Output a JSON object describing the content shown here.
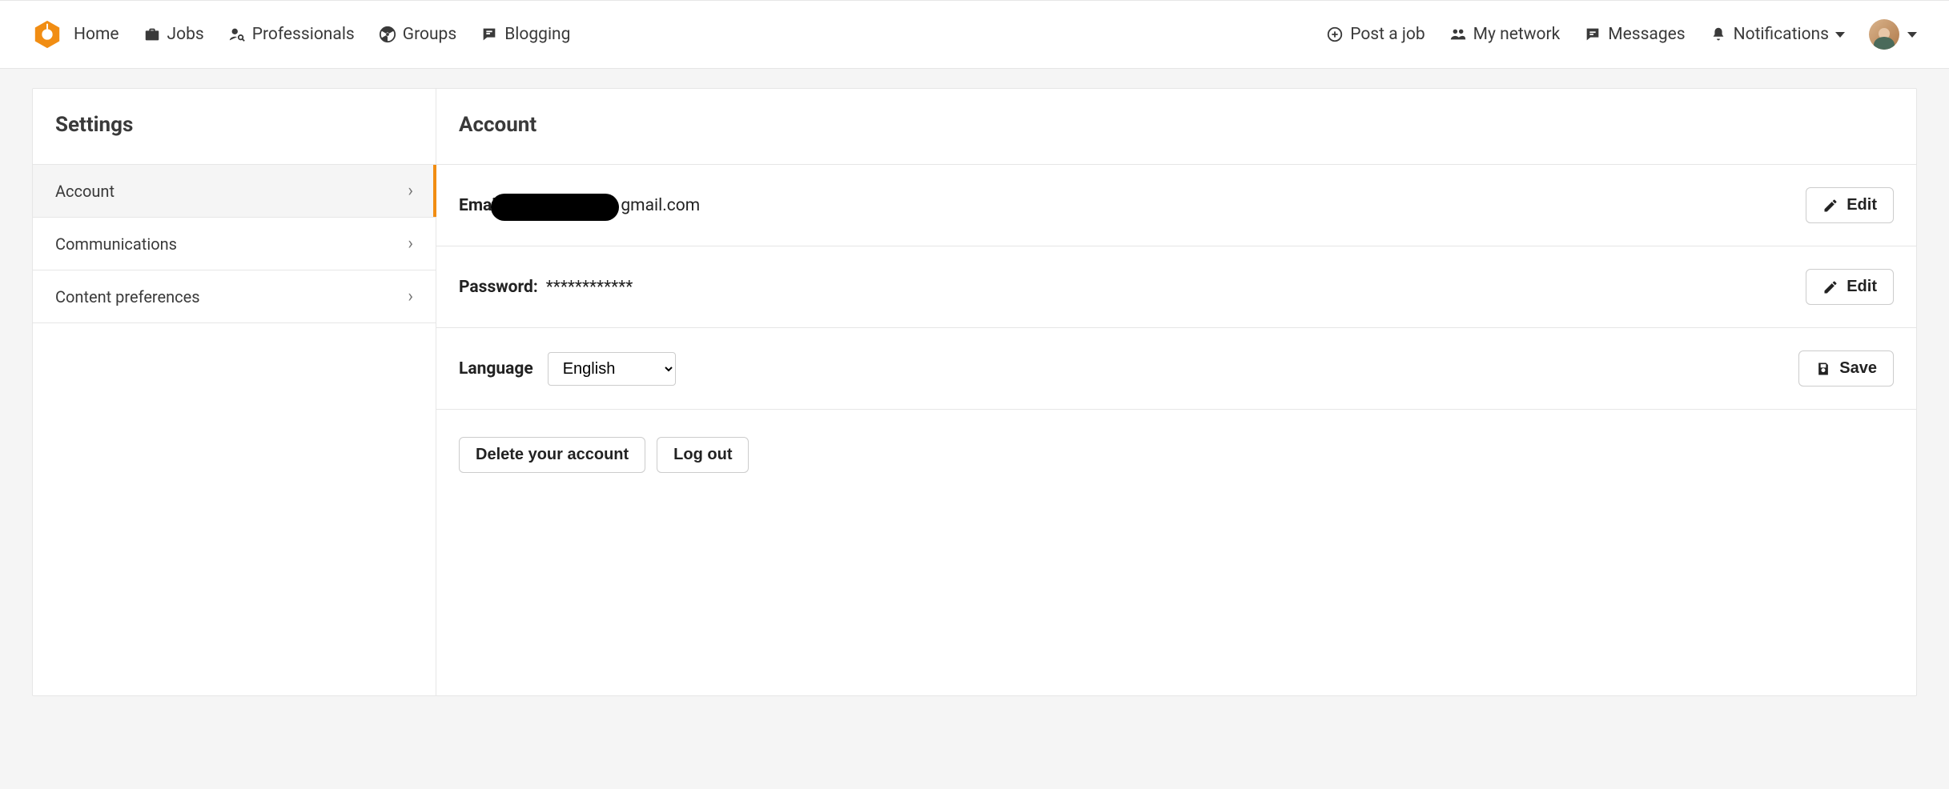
{
  "nav": {
    "home": "Home",
    "jobs": "Jobs",
    "professionals": "Professionals",
    "groups": "Groups",
    "blogging": "Blogging",
    "post_a_job": "Post a job",
    "my_network": "My network",
    "messages": "Messages",
    "notifications": "Notifications"
  },
  "sidebar": {
    "title": "Settings",
    "items": [
      {
        "label": "Account",
        "active": true
      },
      {
        "label": "Communications",
        "active": false
      },
      {
        "label": "Content preferences",
        "active": false
      }
    ]
  },
  "main": {
    "title": "Account",
    "email_label": "Email",
    "email_suffix": "gmail.com",
    "password_label": "Password:",
    "password_value": "************",
    "language_label": "Language",
    "language_value": "English",
    "edit_label": "Edit",
    "save_label": "Save",
    "delete_label": "Delete your account",
    "logout_label": "Log out"
  }
}
